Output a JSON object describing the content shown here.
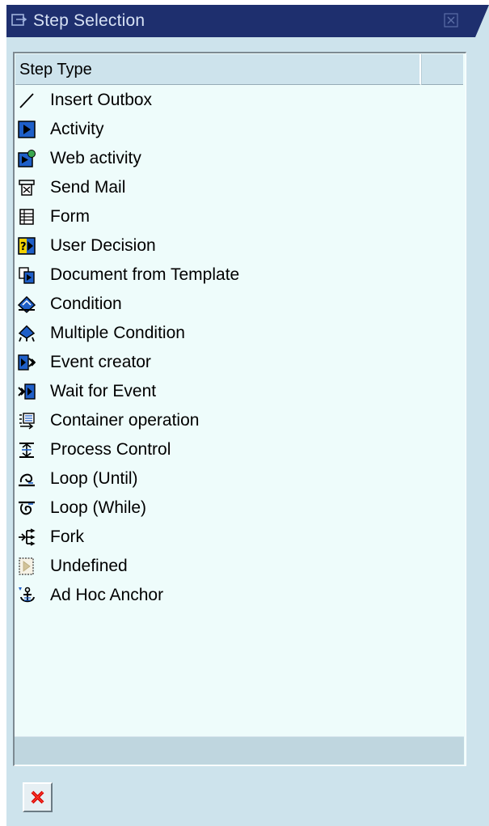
{
  "window": {
    "title": "Step Selection"
  },
  "table": {
    "column_header": "Step Type",
    "rows": [
      {
        "label": "Insert Outbox",
        "icon": "line-icon"
      },
      {
        "label": "Activity",
        "icon": "activity-icon"
      },
      {
        "label": "Web activity",
        "icon": "web-activity-icon"
      },
      {
        "label": "Send Mail",
        "icon": "send-mail-icon"
      },
      {
        "label": "Form",
        "icon": "form-icon"
      },
      {
        "label": "User Decision",
        "icon": "user-decision-icon"
      },
      {
        "label": "Document from Template",
        "icon": "document-template-icon"
      },
      {
        "label": "Condition",
        "icon": "condition-icon"
      },
      {
        "label": "Multiple Condition",
        "icon": "multiple-condition-icon"
      },
      {
        "label": "Event creator",
        "icon": "event-creator-icon"
      },
      {
        "label": "Wait for Event",
        "icon": "wait-event-icon"
      },
      {
        "label": "Container operation",
        "icon": "container-operation-icon"
      },
      {
        "label": "Process Control",
        "icon": "process-control-icon"
      },
      {
        "label": "Loop (Until)",
        "icon": "loop-until-icon"
      },
      {
        "label": "Loop (While)",
        "icon": "loop-while-icon"
      },
      {
        "label": "Fork",
        "icon": "fork-icon"
      },
      {
        "label": "Undefined",
        "icon": "undefined-icon"
      },
      {
        "label": "Ad Hoc Anchor",
        "icon": "anchor-icon"
      }
    ]
  },
  "footer": {
    "cancel_icon": "cancel-icon"
  },
  "colors": {
    "titlebar": "#1e2f6e",
    "window_bg": "#cde3ec",
    "list_bg": "#eefcfb",
    "icon_blue": "#1f5fc8"
  }
}
